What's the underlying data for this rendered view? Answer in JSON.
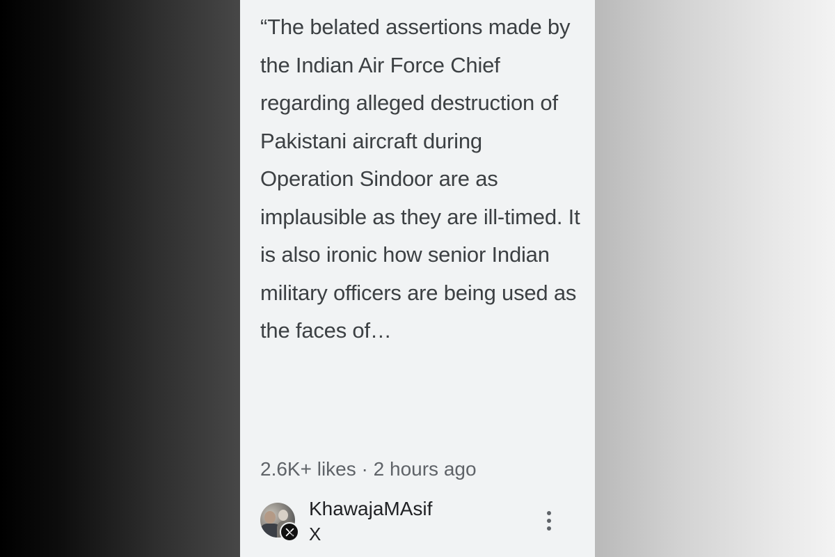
{
  "post": {
    "quote": "“The belated assertions made by the Indian Air Force Chief regarding alleged destruction of Pakistani aircraft during Operation Sindoor are as implausible as they are ill-timed. It is also ironic how senior Indian military officers are being used as the faces of…",
    "likes": "2.6K+ likes",
    "separator": "·",
    "time_ago": "2 hours ago"
  },
  "author": {
    "name": "KhawajaMAsif",
    "source": "X",
    "avatar_icon": "profile-photo",
    "source_icon": "x-logo-icon"
  },
  "actions": {
    "more_icon": "more-vert-icon"
  },
  "colors": {
    "card_background": "#f1f3f4",
    "quote_text": "#3c4043",
    "meta_text": "#5f6368",
    "author_text": "#202124"
  }
}
